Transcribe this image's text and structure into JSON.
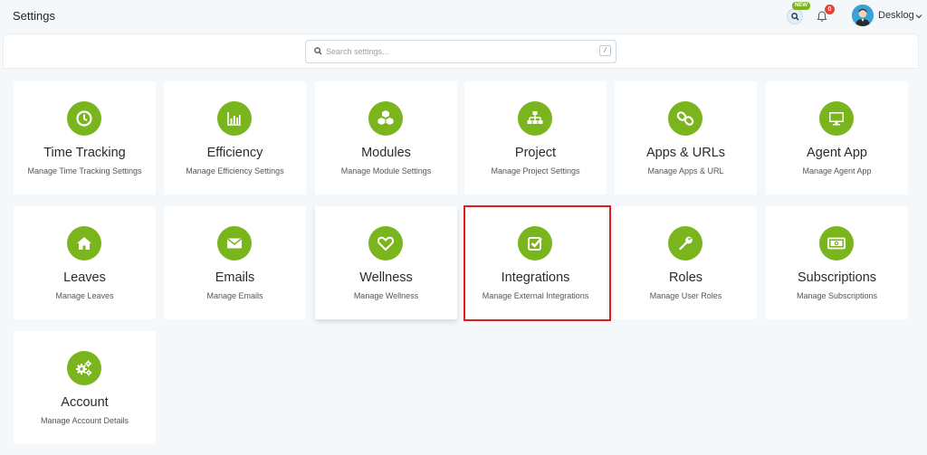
{
  "header": {
    "title": "Settings",
    "new_badge": "NEW",
    "notification_count": "0",
    "user_name": "Desklog"
  },
  "search": {
    "placeholder": "Search settings...",
    "shortcut": "/"
  },
  "colors": {
    "accent": "#7ab51d",
    "highlight": "#e01b1b",
    "badge_red": "#e0443a"
  },
  "cards": [
    {
      "title": "Time Tracking",
      "subtitle": "Manage Time Tracking Settings",
      "icon": "clock-icon"
    },
    {
      "title": "Efficiency",
      "subtitle": "Manage Efficiency Settings",
      "icon": "bar-chart-icon"
    },
    {
      "title": "Modules",
      "subtitle": "Manage Module Settings",
      "icon": "cubes-icon"
    },
    {
      "title": "Project",
      "subtitle": "Manage Project Settings",
      "icon": "sitemap-icon"
    },
    {
      "title": "Apps & URLs",
      "subtitle": "Manage Apps & URL",
      "icon": "link-icon"
    },
    {
      "title": "Agent App",
      "subtitle": "Manage Agent App",
      "icon": "monitor-icon"
    },
    {
      "title": "Leaves",
      "subtitle": "Manage Leaves",
      "icon": "home-icon"
    },
    {
      "title": "Emails",
      "subtitle": "Manage Emails",
      "icon": "envelope-icon"
    },
    {
      "title": "Wellness",
      "subtitle": "Manage Wellness",
      "icon": "heart-icon"
    },
    {
      "title": "Integrations",
      "subtitle": "Manage External Integrations",
      "icon": "check-square-icon"
    },
    {
      "title": "Roles",
      "subtitle": "Manage User Roles",
      "icon": "wrench-icon"
    },
    {
      "title": "Subscriptions",
      "subtitle": "Manage Subscriptions",
      "icon": "money-icon"
    },
    {
      "title": "Account",
      "subtitle": "Manage Account Details",
      "icon": "gears-icon"
    }
  ]
}
